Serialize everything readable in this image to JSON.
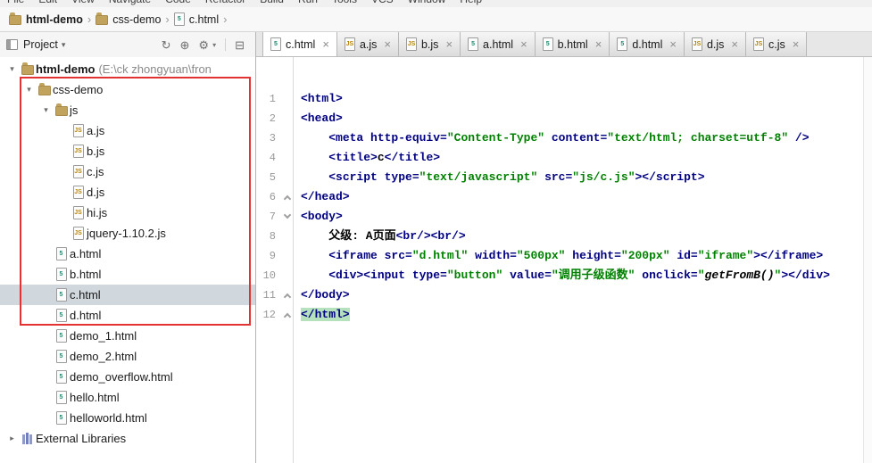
{
  "menu": {
    "items": [
      "File",
      "Edit",
      "View",
      "Navigate",
      "Code",
      "Refactor",
      "Build",
      "Run",
      "Tools",
      "VCS",
      "Window",
      "Help"
    ]
  },
  "glyphs": {
    "expanded": "▾",
    "collapsed": "▸",
    "caret": "▾",
    "close": "×",
    "separator": "›"
  },
  "breadcrumb": {
    "items": [
      {
        "label": "html-demo",
        "icon": "folder",
        "bold": true
      },
      {
        "label": "css-demo",
        "icon": "folder",
        "bold": false
      },
      {
        "label": "c.html",
        "icon": "html",
        "bold": false
      }
    ]
  },
  "project_panel": {
    "title": "Project",
    "header_icons": [
      {
        "name": "refresh-icon",
        "glyph": "↻"
      },
      {
        "name": "scroll-from-source-icon",
        "glyph": "⊕"
      },
      {
        "name": "settings-icon",
        "glyph": "⚙",
        "dropdown": true
      },
      {
        "name": "collapse-all-icon",
        "glyph": "⊟"
      }
    ],
    "tree": [
      {
        "label": "html-demo",
        "suffix": "(E:\\ck zhongyuan\\fron",
        "icon": "folder",
        "level": 0,
        "arrow": "expanded",
        "bold": true
      },
      {
        "label": "css-demo",
        "icon": "folder",
        "level": 1,
        "arrow": "expanded"
      },
      {
        "label": "js",
        "icon": "folder",
        "level": 2,
        "arrow": "expanded"
      },
      {
        "label": "a.js",
        "icon": "js",
        "level": 3
      },
      {
        "label": "b.js",
        "icon": "js",
        "level": 3
      },
      {
        "label": "c.js",
        "icon": "js",
        "level": 3
      },
      {
        "label": "d.js",
        "icon": "js",
        "level": 3
      },
      {
        "label": "hi.js",
        "icon": "js",
        "level": 3
      },
      {
        "label": "jquery-1.10.2.js",
        "icon": "js",
        "level": 3
      },
      {
        "label": "a.html",
        "icon": "html",
        "level": 2
      },
      {
        "label": "b.html",
        "icon": "html",
        "level": 2
      },
      {
        "label": "c.html",
        "icon": "html",
        "level": 2,
        "selected": true
      },
      {
        "label": "d.html",
        "icon": "html",
        "level": 2
      },
      {
        "label": "demo_1.html",
        "icon": "html",
        "level": 2
      },
      {
        "label": "demo_2.html",
        "icon": "html",
        "level": 2
      },
      {
        "label": "demo_overflow.html",
        "icon": "html",
        "level": 2
      },
      {
        "label": "hello.html",
        "icon": "html",
        "level": 2
      },
      {
        "label": "helloworld.html",
        "icon": "html",
        "level": 2
      },
      {
        "label": "External Libraries",
        "icon": "lib",
        "level": 0,
        "arrow": "collapsed"
      }
    ]
  },
  "tabs": [
    {
      "label": "c.html",
      "icon": "html",
      "active": true
    },
    {
      "label": "a.js",
      "icon": "js",
      "active": false
    },
    {
      "label": "b.js",
      "icon": "js",
      "active": false
    },
    {
      "label": "a.html",
      "icon": "html",
      "active": false
    },
    {
      "label": "b.html",
      "icon": "html",
      "active": false
    },
    {
      "label": "d.html",
      "icon": "html",
      "active": false
    },
    {
      "label": "d.js",
      "icon": "js",
      "active": false
    },
    {
      "label": "c.js",
      "icon": "js",
      "active": false
    }
  ],
  "editor": {
    "lines": [
      {
        "num": 1,
        "segments": [
          [
            "tag",
            "<html>"
          ]
        ]
      },
      {
        "num": 2,
        "segments": [
          [
            "tag",
            "<head>"
          ]
        ]
      },
      {
        "num": 3,
        "segments": [
          [
            "plain",
            "    "
          ],
          [
            "tag",
            "<meta http-equiv="
          ],
          [
            "val",
            "\"Content-Type\""
          ],
          [
            "tag",
            " content="
          ],
          [
            "val",
            "\"text/html; charset=utf-8\""
          ],
          [
            "tag",
            " />"
          ]
        ]
      },
      {
        "num": 4,
        "segments": [
          [
            "plain",
            "    "
          ],
          [
            "tag",
            "<title>"
          ],
          [
            "plain",
            "c"
          ],
          [
            "tag",
            "</title>"
          ]
        ]
      },
      {
        "num": 5,
        "segments": [
          [
            "plain",
            "    "
          ],
          [
            "tag",
            "<script type="
          ],
          [
            "val",
            "\"text/javascript\""
          ],
          [
            "tag",
            " src="
          ],
          [
            "val",
            "\"js/c.js\""
          ],
          [
            "tag",
            "></script>"
          ]
        ]
      },
      {
        "num": 6,
        "fold": "end",
        "segments": [
          [
            "tag",
            "</head>"
          ]
        ]
      },
      {
        "num": 7,
        "fold": "start",
        "segments": [
          [
            "tag",
            "<body>"
          ]
        ]
      },
      {
        "num": 8,
        "segments": [
          [
            "plain",
            "    父级: A页面"
          ],
          [
            "tag",
            "<br/><br/>"
          ]
        ]
      },
      {
        "num": 9,
        "segments": [
          [
            "plain",
            "    "
          ],
          [
            "tag",
            "<iframe src="
          ],
          [
            "val",
            "\"d.html\""
          ],
          [
            "tag",
            " width="
          ],
          [
            "val",
            "\"500px\""
          ],
          [
            "tag",
            " height="
          ],
          [
            "val",
            "\"200px\""
          ],
          [
            "tag",
            " id="
          ],
          [
            "val",
            "\"iframe\""
          ],
          [
            "tag",
            "></iframe>"
          ]
        ]
      },
      {
        "num": 10,
        "segments": [
          [
            "plain",
            "    "
          ],
          [
            "tag",
            "<div><input type="
          ],
          [
            "val",
            "\"button\""
          ],
          [
            "tag",
            " value="
          ],
          [
            "val",
            "\"调用子级函数\""
          ],
          [
            "tag",
            " onclick="
          ],
          [
            "val",
            "\""
          ],
          [
            "js",
            "getFromB()"
          ],
          [
            "val",
            "\""
          ],
          [
            "tag",
            "></div>"
          ]
        ]
      },
      {
        "num": 11,
        "fold": "end",
        "segments": [
          [
            "tag",
            "</body>"
          ]
        ]
      },
      {
        "num": 12,
        "fold": "end",
        "hl": true,
        "segments": [
          [
            "tag",
            "</html>"
          ]
        ]
      }
    ]
  },
  "colors": {
    "tag": "#000080",
    "value": "#008000",
    "annotation": "#e23232",
    "selection": "#d0d8de",
    "highlight": "#b5e2bd"
  }
}
